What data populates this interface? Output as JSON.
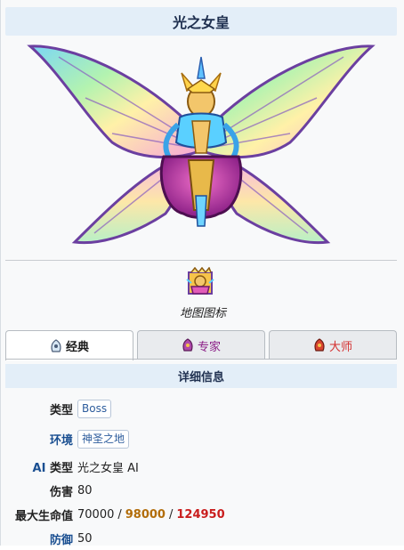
{
  "title": "光之女皇",
  "map_icon": {
    "caption": "地图图标"
  },
  "tabs": [
    {
      "label": "经典",
      "icon": "classic-mode-icon"
    },
    {
      "label": "专家",
      "icon": "expert-mode-icon"
    },
    {
      "label": "大师",
      "icon": "master-mode-icon"
    }
  ],
  "section_title": "详细信息",
  "info": {
    "type_label": "类型",
    "type_value": "Boss",
    "env_label": "环境",
    "env_value": "神圣之地",
    "ai_label_prefix": "AI",
    "ai_label_suffix": "类型",
    "ai_value": "光之女皇 AI",
    "damage_label": "伤害",
    "damage_value": "80",
    "hp_label": "最大生命值",
    "hp_classic": "70000",
    "hp_sep1": "/",
    "hp_expert": "98000",
    "hp_sep2": "/",
    "hp_master": "124950",
    "defense_label": "防御",
    "defense_value": "50"
  },
  "colors": {
    "header_bg": "#e3eef8",
    "expert": "#b26d0a",
    "master": "#c91d1d",
    "link": "#1a4f91"
  }
}
